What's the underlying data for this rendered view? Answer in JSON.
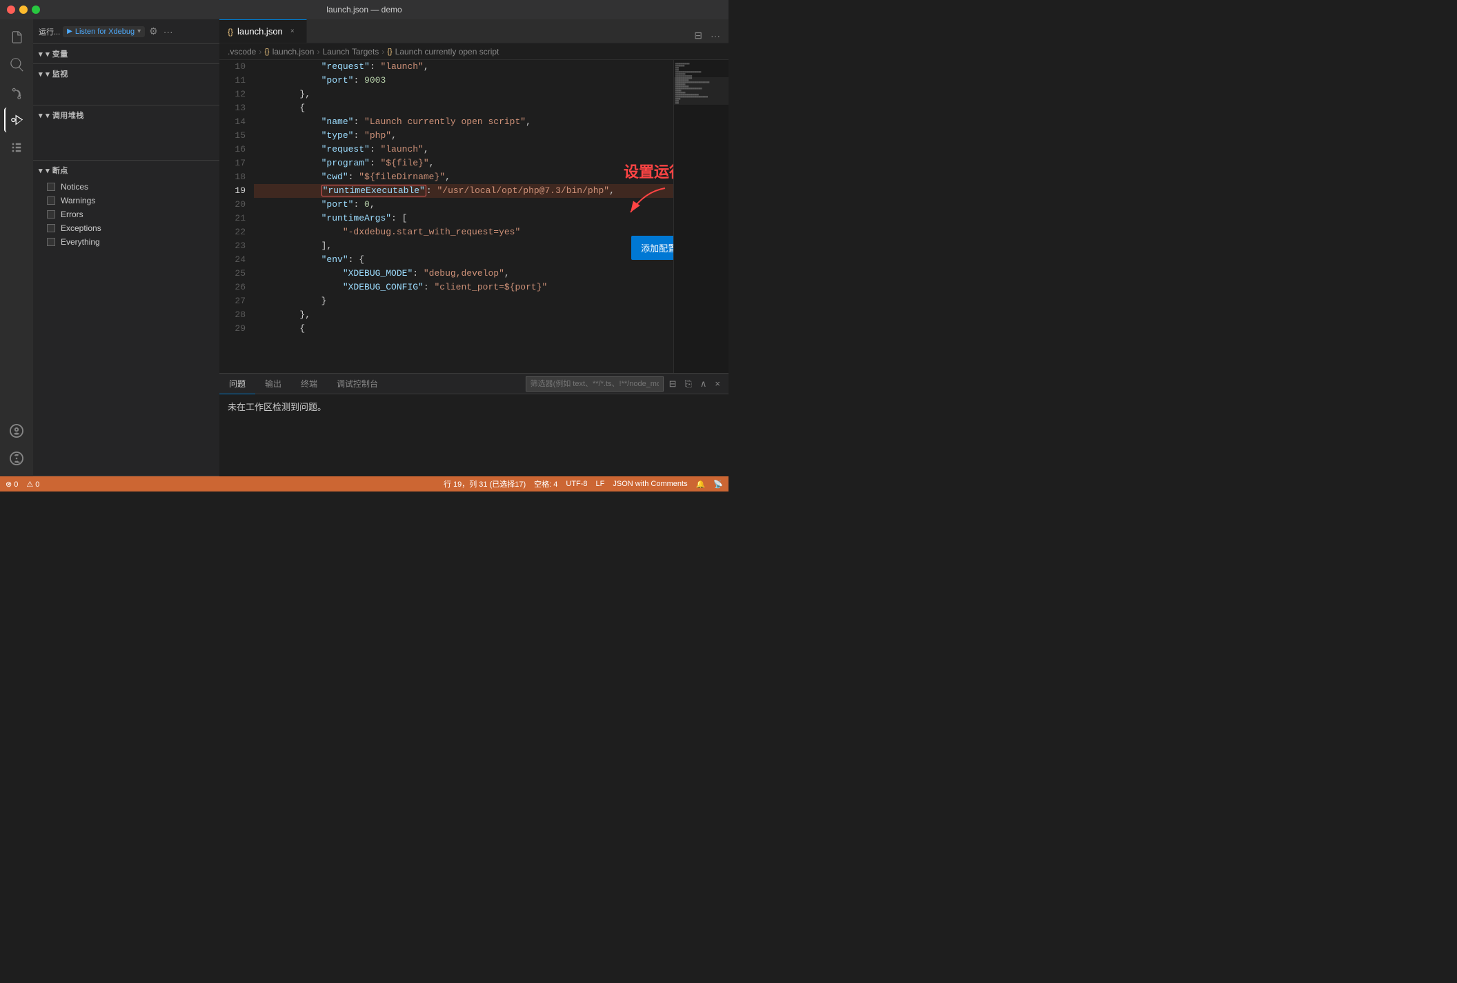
{
  "titlebar": {
    "title": "launch.json — demo"
  },
  "activity_bar": {
    "icons": [
      {
        "name": "explorer-icon",
        "symbol": "⎗",
        "active": false
      },
      {
        "name": "search-icon",
        "symbol": "🔍",
        "active": false
      },
      {
        "name": "source-control-icon",
        "symbol": "⑂",
        "active": false
      },
      {
        "name": "run-icon",
        "symbol": "▶",
        "active": true
      },
      {
        "name": "extensions-icon",
        "symbol": "⊞",
        "active": false
      }
    ],
    "bottom_icons": [
      {
        "name": "account-icon",
        "symbol": "👤"
      },
      {
        "name": "settings-icon",
        "symbol": "⚙"
      }
    ]
  },
  "sidebar": {
    "debug_toolbar": {
      "run_label": "运行...",
      "listen_label": "Listen for Xdebug",
      "gear_label": "⚙",
      "more_label": "···"
    },
    "variables": {
      "header": "▾ 变量"
    },
    "watch": {
      "header": "▾ 监视"
    },
    "callstack": {
      "header": "▾ 调用堆栈"
    },
    "breakpoints": {
      "header": "▾ 断点",
      "items": [
        {
          "label": "Notices"
        },
        {
          "label": "Warnings"
        },
        {
          "label": "Errors"
        },
        {
          "label": "Exceptions"
        },
        {
          "label": "Everything"
        }
      ]
    }
  },
  "editor": {
    "tab": {
      "icon": "{}",
      "label": "launch.json",
      "close": "×"
    },
    "breadcrumb": [
      {
        "text": ".vscode"
      },
      {
        "text": "{} launch.json"
      },
      {
        "text": "Launch Targets"
      },
      {
        "text": "{} Launch currently open script"
      }
    ],
    "lines": [
      {
        "num": 10,
        "content": "            \"request\": \"launch\",",
        "type": "normal"
      },
      {
        "num": 11,
        "content": "            \"port\": 9003",
        "type": "normal"
      },
      {
        "num": 12,
        "content": "        },",
        "type": "normal"
      },
      {
        "num": 13,
        "content": "        {",
        "type": "normal"
      },
      {
        "num": 14,
        "content": "            \"name\": \"Launch currently open script\",",
        "type": "normal"
      },
      {
        "num": 15,
        "content": "            \"type\": \"php\",",
        "type": "normal"
      },
      {
        "num": 16,
        "content": "            \"request\": \"launch\",",
        "type": "normal"
      },
      {
        "num": 17,
        "content": "            \"program\": \"${file}\",",
        "type": "normal"
      },
      {
        "num": 18,
        "content": "            \"cwd\": \"${fileDirname}\",",
        "type": "normal"
      },
      {
        "num": 19,
        "content": "            \"runtimeExecutable\": \"/usr/local/opt/php@7.3/bin/php\",",
        "type": "highlighted"
      },
      {
        "num": 20,
        "content": "            \"port\": 0,",
        "type": "normal"
      },
      {
        "num": 21,
        "content": "            \"runtimeArgs\": [",
        "type": "normal"
      },
      {
        "num": 22,
        "content": "                \"-dxdebug.start_with_request=yes\"",
        "type": "normal"
      },
      {
        "num": 23,
        "content": "            ],",
        "type": "normal"
      },
      {
        "num": 24,
        "content": "            \"env\": {",
        "type": "normal"
      },
      {
        "num": 25,
        "content": "                \"XDEBUG_MODE\": \"debug,develop\",",
        "type": "normal"
      },
      {
        "num": 26,
        "content": "                \"XDEBUG_CONFIG\": \"client_port=${port}\"",
        "type": "normal"
      },
      {
        "num": 27,
        "content": "            }",
        "type": "normal"
      },
      {
        "num": 28,
        "content": "        },",
        "type": "normal"
      },
      {
        "num": 29,
        "content": "        {",
        "type": "normal"
      }
    ],
    "annotation": {
      "text": "设置运行路径"
    },
    "add_config_btn": "添加配置..."
  },
  "bottom_panel": {
    "tabs": [
      {
        "label": "问题",
        "active": true
      },
      {
        "label": "输出",
        "active": false
      },
      {
        "label": "终端",
        "active": false
      },
      {
        "label": "调试控制台",
        "active": false
      }
    ],
    "filter_placeholder": "筛选器(例如 text、**/*.ts、!**/node_modules/**)",
    "no_problems_msg": "未在工作区检测到问题。"
  },
  "status_bar": {
    "errors": "⊗ 0",
    "warnings": "⚠ 0",
    "position": "行 19，列 31 (已选择17)",
    "spaces": "空格: 4",
    "encoding": "UTF-8",
    "line_ending": "LF",
    "language": "JSON with Comments",
    "notification_icon": "🔔",
    "broadcast_icon": "📡"
  }
}
